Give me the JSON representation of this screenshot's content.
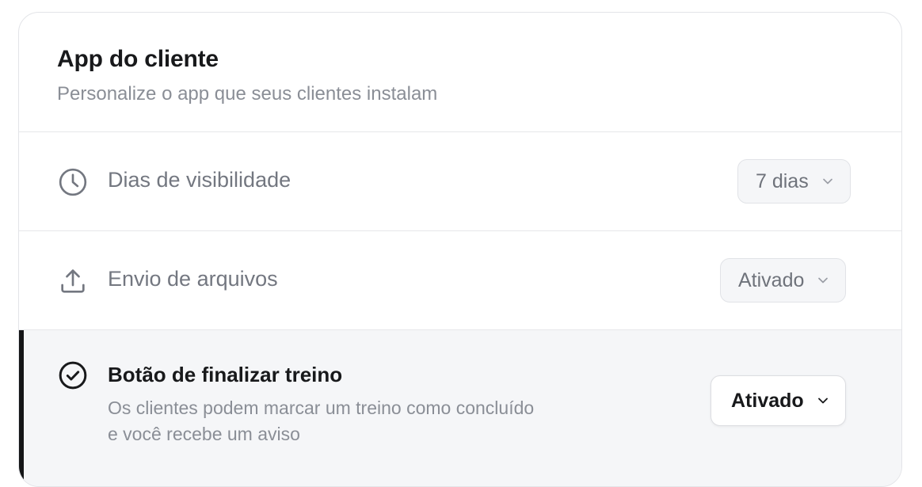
{
  "section": {
    "title": "App do cliente",
    "subtitle": "Personalize o app que seus clientes instalam"
  },
  "settings": [
    {
      "label": "Dias de visibilidade",
      "icon": "clock-icon",
      "value": "7 dias"
    },
    {
      "label": "Envio de arquivos",
      "icon": "upload-icon",
      "value": "Ativado"
    },
    {
      "label": "Botão de finalizar treino",
      "icon": "check-circle-icon",
      "description_line1": "Os clientes podem marcar um treino como concluído",
      "description_line2": "e você recebe um aviso",
      "value": "Ativado",
      "selected": true
    }
  ],
  "colors": {
    "accent": "#141517",
    "muted_text": "#8a8e96",
    "selected_row_bg": "#f5f6f8"
  }
}
